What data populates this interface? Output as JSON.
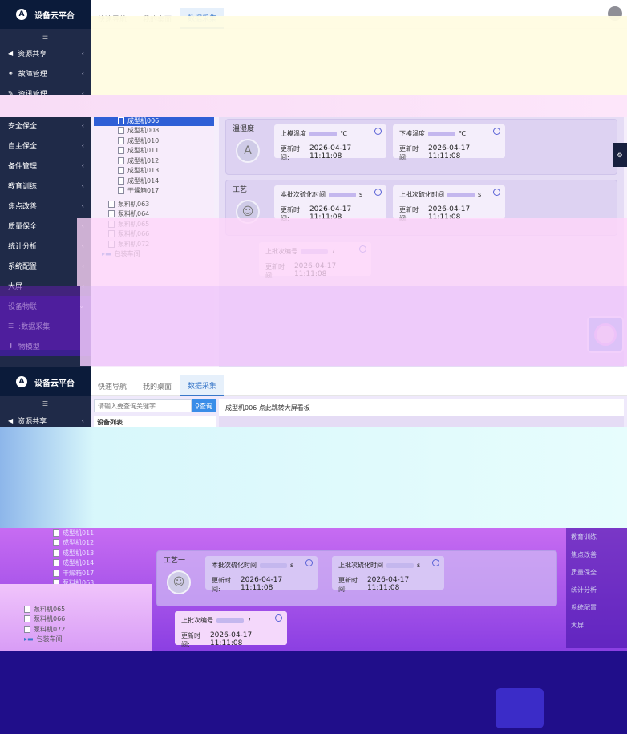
{
  "app": {
    "brand_name": "设备云平台",
    "brand_logo": "A",
    "fold_icon": "☰"
  },
  "tabs": [
    {
      "label": "快速导航",
      "active": false
    },
    {
      "label": "我的桌面",
      "active": false
    },
    {
      "label": "数据采集",
      "active": true
    }
  ],
  "sidebar_top": [
    {
      "label": "资源共享",
      "icon": "share-icon",
      "glyph": "◀"
    },
    {
      "label": "故障管理",
      "icon": "users-icon",
      "glyph": "⚭"
    },
    {
      "label": "资讯管理",
      "icon": "wrench-icon",
      "glyph": "✎"
    }
  ],
  "sidebar_a": [
    {
      "label": "安全保全"
    },
    {
      "label": "自主保全"
    },
    {
      "label": "备件管理"
    },
    {
      "label": "教育训练"
    },
    {
      "label": "焦点改善"
    },
    {
      "label": "质量保全"
    },
    {
      "label": "统计分析"
    },
    {
      "label": "系统配置"
    },
    {
      "label": "大屏"
    },
    {
      "label": "设备物联"
    }
  ],
  "sidebar_bottom_a": [
    {
      "label": ":数据采集",
      "glyph": "☰"
    },
    {
      "label": "物模型",
      "glyph": "⬇"
    }
  ],
  "sidebar_b": [
    {
      "label": "资源共享"
    },
    {
      "label": "故障管理"
    },
    {
      "label": "资讯管理"
    },
    {
      "label": "安全保全"
    },
    {
      "label": "自主保全"
    }
  ],
  "search": {
    "placeholder": "请输入要查询关键字",
    "button": "查询"
  },
  "tree": {
    "title": "设备列表",
    "nodes_a_1": [
      {
        "label": "成型机006",
        "selected": true
      },
      {
        "label": "成型机008"
      },
      {
        "label": "成型机010"
      },
      {
        "label": "成型机011"
      },
      {
        "label": "成型机012"
      },
      {
        "label": "成型机013"
      },
      {
        "label": "成型机014"
      },
      {
        "label": "干燥箱017"
      }
    ],
    "nodes_a_2": [
      {
        "label": "泵料机063"
      },
      {
        "label": "泵料机064"
      },
      {
        "label": "泵料机065"
      },
      {
        "label": "泵料机066"
      },
      {
        "label": "泵料机072"
      }
    ],
    "folder_a": "包装车间",
    "nodes_b": [
      {
        "label": "成型机011"
      },
      {
        "label": "成型机012"
      },
      {
        "label": "成型机013"
      },
      {
        "label": "成型机014"
      },
      {
        "label": "干燥箱017"
      },
      {
        "label": "泵料机063"
      },
      {
        "label": "泵料机064"
      }
    ],
    "nodes_b_2": [
      {
        "label": "泵料机065"
      },
      {
        "label": "泵料机066"
      },
      {
        "label": "泵料机072"
      }
    ],
    "folder_b": "包装车间"
  },
  "panel": {
    "header": "成型机006 点此跳转大屏看板"
  },
  "groups": {
    "temperature_label": "温湿度",
    "temperature_avatar": "A",
    "process_label": "工艺一"
  },
  "cards": {
    "upper_temp": {
      "title": "上模温度",
      "unit": "℃"
    },
    "lower_temp": {
      "title": "下模温度",
      "unit": "℃"
    },
    "cure_time": {
      "title": "本批次硫化时间",
      "unit": "s"
    },
    "last_cure_time": {
      "title": "上批次硫化时间",
      "unit": "s"
    },
    "last_batch": {
      "title": "上批次编号",
      "unit": "7"
    },
    "update_label": "更新时间:",
    "update_time": "2026-04-17 11:11:08"
  },
  "right_dock_b": [
    {
      "label": "教育训练"
    },
    {
      "label": "焦点改善"
    },
    {
      "label": "质量保全"
    },
    {
      "label": "统计分析"
    },
    {
      "label": "系统配置"
    },
    {
      "label": "大屏"
    }
  ]
}
